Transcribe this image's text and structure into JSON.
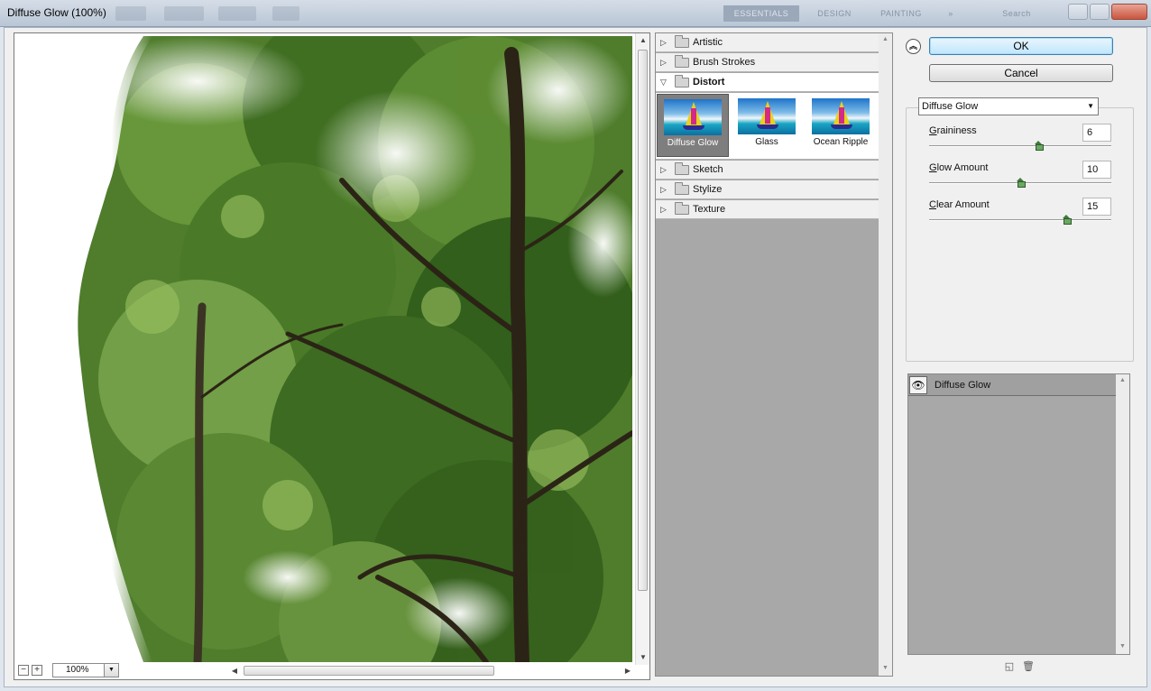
{
  "window": {
    "title": "Diffuse Glow (100%)"
  },
  "ps_bar": {
    "workspace_tabs": [
      "ESSENTIALS",
      "DESIGN",
      "PAINTING",
      "»"
    ],
    "search_placeholder": "Search"
  },
  "preview": {
    "zoom_value": "100%",
    "zoom_out_glyph": "−",
    "zoom_in_glyph": "+"
  },
  "filter_gallery": {
    "categories": [
      {
        "label": "Artistic",
        "expanded": false
      },
      {
        "label": "Brush Strokes",
        "expanded": false
      },
      {
        "label": "Distort",
        "expanded": true
      },
      {
        "label": "Sketch",
        "expanded": false
      },
      {
        "label": "Stylize",
        "expanded": false
      },
      {
        "label": "Texture",
        "expanded": false
      }
    ],
    "distort_filters": [
      {
        "label": "Diffuse Glow",
        "selected": true
      },
      {
        "label": "Glass",
        "selected": false
      },
      {
        "label": "Ocean Ripple",
        "selected": false
      }
    ]
  },
  "buttons": {
    "ok": "OK",
    "cancel": "Cancel"
  },
  "settings": {
    "filter_select": "Diffuse Glow",
    "params": [
      {
        "label": "Graininess",
        "mnemonic": "G",
        "rest": "raininess",
        "value": "6",
        "level": 0.6
      },
      {
        "label": "Glow Amount",
        "mnemonic": "G",
        "rest": "low Amount",
        "value": "10",
        "level": 0.5
      },
      {
        "label": "Clear Amount",
        "mnemonic": "C",
        "rest": "lear Amount",
        "value": "15",
        "level": 0.75
      }
    ]
  },
  "layers": [
    {
      "label": "Diffuse Glow",
      "visible": true
    }
  ],
  "icons": {
    "collapse": "chevron-double-up-icon",
    "eye": "eye-icon",
    "new_layer": "new-effect-layer-icon",
    "delete": "trash-icon",
    "folder": "folder-icon"
  },
  "colors": {
    "ok_button": "#bee6fd",
    "list_background": "#a8a8a8",
    "slider_knob": "#6aa862"
  }
}
